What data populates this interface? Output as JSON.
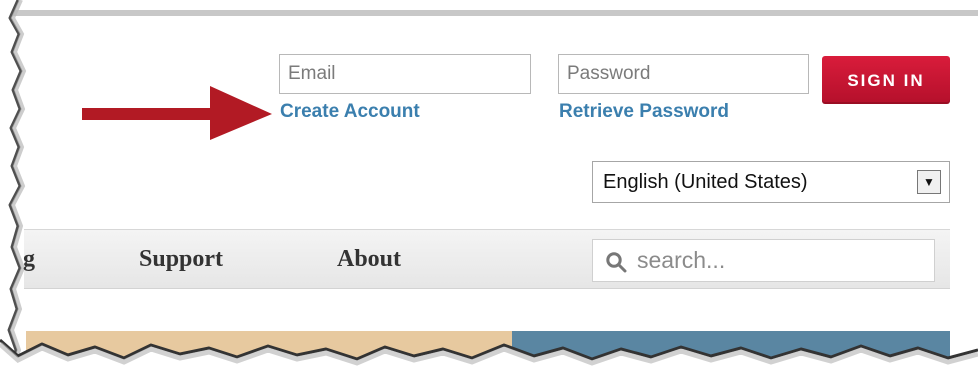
{
  "auth": {
    "email_placeholder": "Email",
    "password_placeholder": "Password",
    "sign_in_label": "SIGN IN",
    "create_account_label": "Create Account",
    "retrieve_password_label": "Retrieve Password"
  },
  "language": {
    "selected": "English (United States)",
    "caret_icon": "▼"
  },
  "nav": {
    "partial_item": "g",
    "items": [
      {
        "label": "Support"
      },
      {
        "label": "About"
      }
    ]
  },
  "search": {
    "placeholder": "search...",
    "icon": "search-icon"
  },
  "colors": {
    "link": "#3b7fae",
    "sign_in": "#d91c3b",
    "arrow": "#b21a24",
    "nav_background": "#eeeeee",
    "tan_banner": "#e7c99f",
    "blue_banner": "#5a86a2"
  }
}
